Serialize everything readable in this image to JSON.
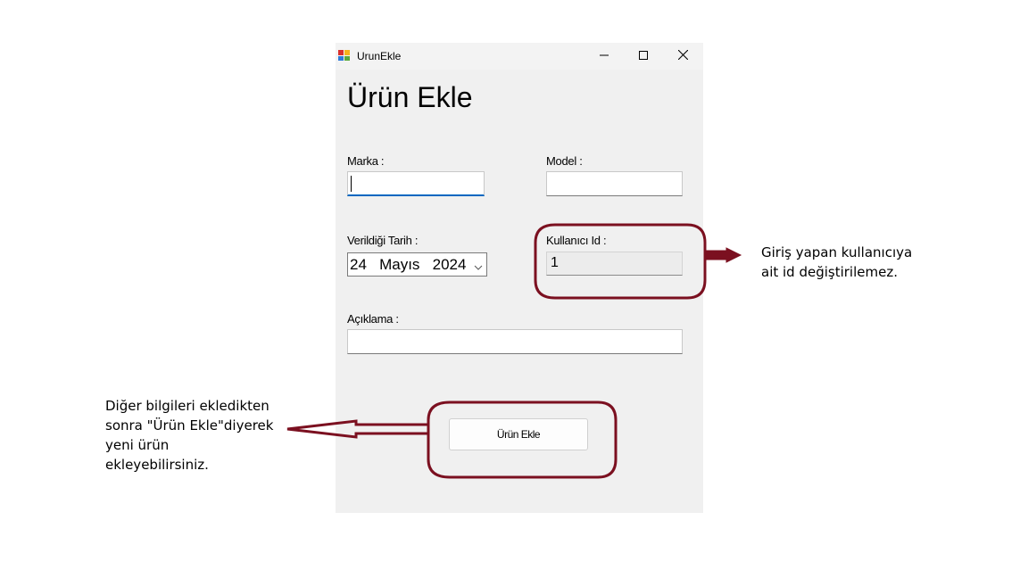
{
  "window": {
    "title": "UrunEkle",
    "heading": "Ürün Ekle"
  },
  "form": {
    "marka_label": "Marka :",
    "marka_value": "",
    "model_label": "Model :",
    "model_value": "",
    "tarih_label": "Verildiği Tarih :",
    "tarih_day": "24",
    "tarih_month": "Mayıs",
    "tarih_year": "2024",
    "kullanici_label": "Kullanıcı Id :",
    "kullanici_value": "1",
    "aciklama_label": "Açıklama :",
    "aciklama_value": "",
    "submit_label": "Ürün Ekle"
  },
  "annotations": {
    "right_line1": "Giriş yapan kullanıcıya",
    "right_line2": "ait id değiştirilemez.",
    "left_line1": "Diğer bilgileri ekledikten",
    "left_line2": "sonra \"Ürün Ekle\"diyerek",
    "left_line3": "yeni ürün",
    "left_line4": "ekleyebilirsiniz."
  },
  "icons": {
    "app": "app-icon",
    "minimize": "minimize-icon",
    "maximize": "maximize-icon",
    "close": "close-icon",
    "dropdown": "chevron-down-icon"
  },
  "colors": {
    "annotation_outline": "#7b1020",
    "window_bg": "#f0f0f0",
    "focus_accent": "#0067c0"
  }
}
